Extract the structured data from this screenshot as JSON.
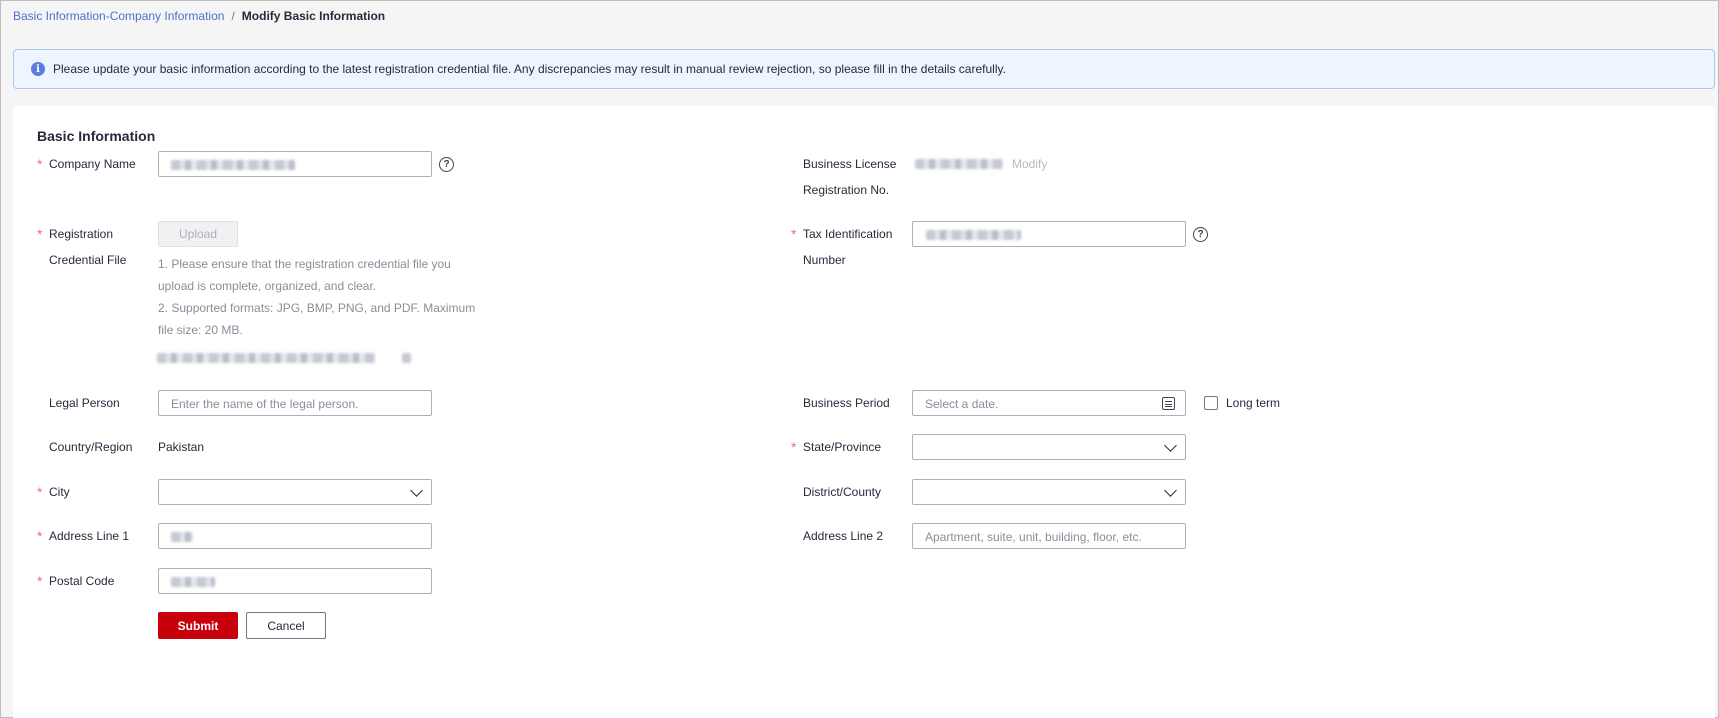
{
  "breadcrumb": {
    "parent": "Basic Information-Company Information",
    "separator": "/",
    "current": "Modify Basic Information"
  },
  "notice": {
    "icon": "info-icon",
    "text": "Please update your basic information according to the latest registration credential file. Any discrepancies may result in manual review rejection, so please fill in the details carefully."
  },
  "form": {
    "section_title": "Basic Information",
    "required_mark": "*",
    "company_name": {
      "label": "Company Name"
    },
    "business_license": {
      "label_line1": "Business License",
      "label_line2": "Registration No.",
      "modify_label": "Modify"
    },
    "registration_file": {
      "label_line1": "Registration",
      "label_line2": "Credential File",
      "upload_label": "Upload",
      "hint_1": "1. Please ensure that the registration credential file you upload is complete, organized, and clear.",
      "hint_2": "2. Supported formats: JPG, BMP, PNG, and PDF. Maximum file size: 20 MB."
    },
    "tax_id": {
      "label_line1": "Tax Identification",
      "label_line2": "Number"
    },
    "legal_person": {
      "label": "Legal Person",
      "placeholder": "Enter the name of the legal person."
    },
    "business_period": {
      "label": "Business Period",
      "placeholder": "Select a date.",
      "long_term_label": "Long term"
    },
    "country_region": {
      "label": "Country/Region",
      "value": "Pakistan"
    },
    "state_province": {
      "label": "State/Province",
      "value": ""
    },
    "city": {
      "label": "City",
      "value": ""
    },
    "district_county": {
      "label": "District/County",
      "value": ""
    },
    "address_line_1": {
      "label": "Address Line 1"
    },
    "address_line_2": {
      "label": "Address Line 2",
      "placeholder": "Apartment, suite, unit, building, floor, etc."
    },
    "postal_code": {
      "label": "Postal Code"
    },
    "submit_label": "Submit",
    "cancel_label": "Cancel"
  },
  "colors": {
    "accent": "#c7000b",
    "link": "#526ecc",
    "required": "#f66f6a",
    "notice_bg": "#eef5fe"
  }
}
